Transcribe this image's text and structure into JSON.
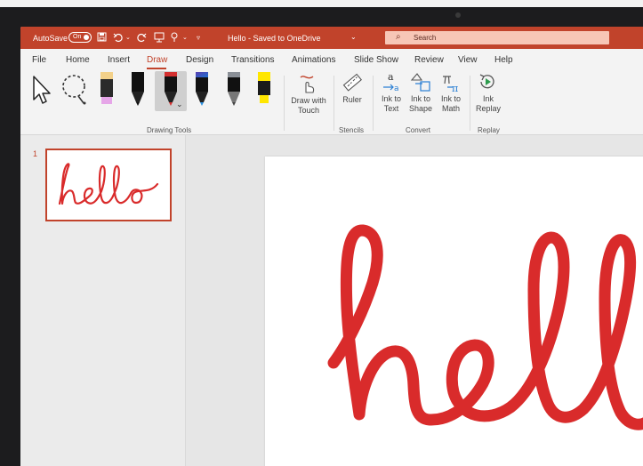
{
  "titlebar": {
    "autosave_label": "AutoSave",
    "autosave_state": "On",
    "doc_title": "Hello - Saved to OneDrive",
    "search_placeholder": "Search"
  },
  "ribbon": {
    "tabs": [
      {
        "label": "File"
      },
      {
        "label": "Home"
      },
      {
        "label": "Insert"
      },
      {
        "label": "Draw"
      },
      {
        "label": "Design"
      },
      {
        "label": "Transitions"
      },
      {
        "label": "Animations"
      },
      {
        "label": "Slide Show"
      },
      {
        "label": "Review"
      },
      {
        "label": "View"
      },
      {
        "label": "Help"
      }
    ],
    "active_tab": "Draw",
    "draw_with_touch": {
      "line1": "Draw with",
      "line2": "Touch"
    },
    "ruler": "Ruler",
    "ink_to_text": {
      "line1": "Ink to",
      "line2": "Text"
    },
    "ink_to_shape": {
      "line1": "Ink to",
      "line2": "Shape"
    },
    "ink_to_math": {
      "line1": "Ink to",
      "line2": "Math"
    },
    "ink_replay": {
      "line1": "Ink",
      "line2": "Replay"
    },
    "groups": {
      "drawing_tools": "Drawing Tools",
      "stencils": "Stencils",
      "convert": "Convert",
      "replay": "Replay"
    },
    "pens": [
      {
        "name": "highlighter-pink",
        "color": "#e6a6e8"
      },
      {
        "name": "pen-black",
        "color": "#111111"
      },
      {
        "name": "pen-red",
        "color": "#d32f2f"
      },
      {
        "name": "pen-blue",
        "color": "#2a8fe0"
      },
      {
        "name": "pen-gray",
        "color": "#8a8f96"
      },
      {
        "name": "highlighter-yellow",
        "color": "#ffe600"
      }
    ]
  },
  "slides": {
    "number": "1",
    "ink_word": "hello"
  },
  "colors": {
    "accent": "#c1432b",
    "ink": "#d92b2b"
  }
}
